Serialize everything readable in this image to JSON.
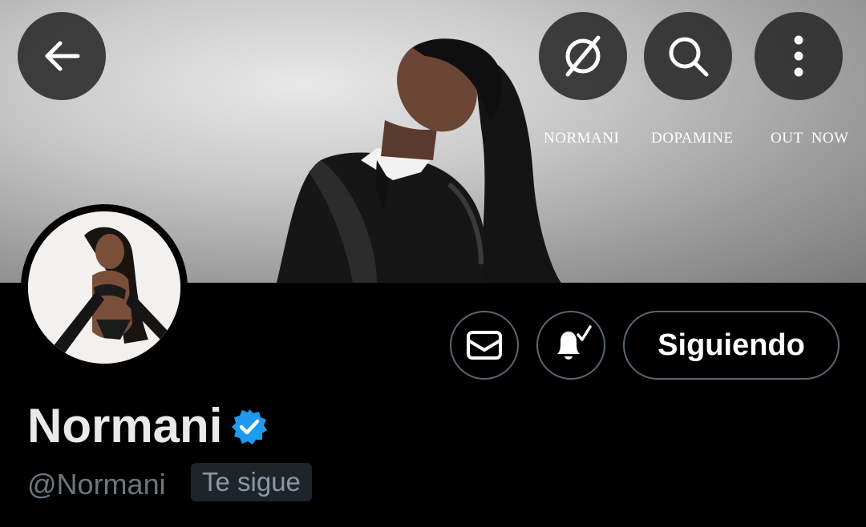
{
  "banner": {
    "texts": [
      "NORMANI",
      "DOPAMINE",
      "OUT  NOW"
    ]
  },
  "toolbar": {
    "back_icon": "arrow-left-icon",
    "translate_icon": "no-circle-icon",
    "search_icon": "search-icon",
    "more_icon": "more-vertical-icon"
  },
  "profile": {
    "name": "Normani",
    "handle": "@Normani",
    "follows_you": "Te sigue",
    "verified": true,
    "verified_color": "#1d9bf0"
  },
  "actions": {
    "message_icon": "envelope-icon",
    "notify_icon": "bell-check-icon",
    "follow_label": "Siguiendo"
  }
}
